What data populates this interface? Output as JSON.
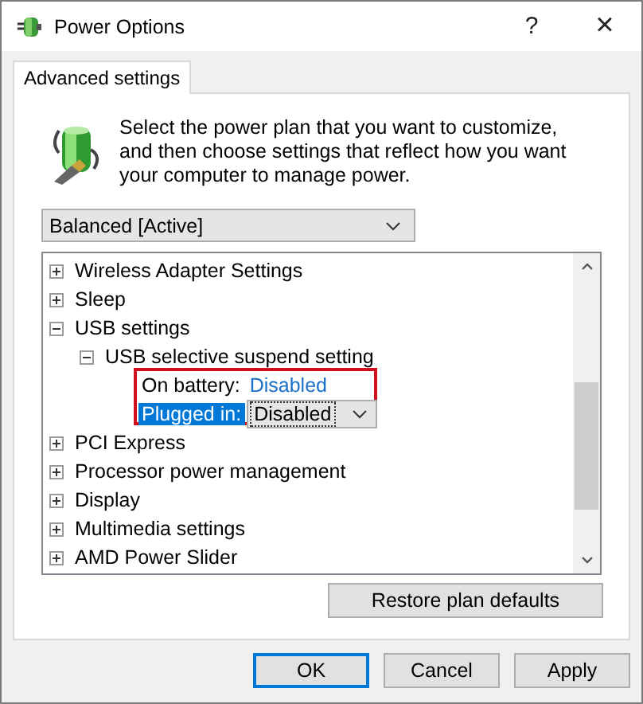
{
  "window": {
    "title": "Power Options",
    "help": "?",
    "close": "×"
  },
  "tabs": [
    {
      "label": "Advanced settings",
      "selected": true
    }
  ],
  "description": "Select the power plan that you want to customize, and then choose settings that reflect how you want your computer to manage power.",
  "plan_dropdown": {
    "value": "Balanced [Active]"
  },
  "tree": [
    {
      "label": "Wireless Adapter Settings",
      "expanded": false
    },
    {
      "label": "Sleep",
      "expanded": false
    },
    {
      "label": "USB settings",
      "expanded": true,
      "children": [
        {
          "label": "USB selective suspend setting",
          "expanded": true,
          "settings": [
            {
              "kind": "link",
              "label": "On battery:",
              "value": "Disabled",
              "selected": false
            },
            {
              "kind": "dropdown",
              "label": "Plugged in:",
              "value": "Disabled",
              "selected": true
            }
          ]
        }
      ]
    },
    {
      "label": "PCI Express",
      "expanded": false
    },
    {
      "label": "Processor power management",
      "expanded": false
    },
    {
      "label": "Display",
      "expanded": false
    },
    {
      "label": "Multimedia settings",
      "expanded": false
    },
    {
      "label": "AMD Power Slider",
      "expanded": false
    }
  ],
  "restore_button": "Restore plan defaults",
  "buttons": [
    {
      "label": "OK",
      "default": true
    },
    {
      "label": "Cancel",
      "default": false
    },
    {
      "label": "Apply",
      "default": false
    }
  ]
}
